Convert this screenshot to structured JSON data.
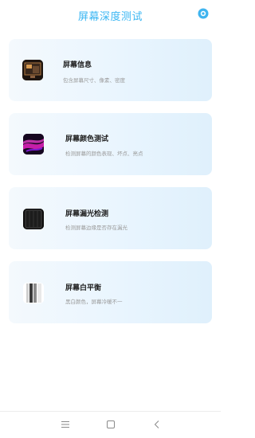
{
  "header": {
    "title": "屏幕深度测试",
    "settings_icon": "settings-icon",
    "accent_color": "#39b6f3"
  },
  "cards": [
    {
      "title": "屏幕信息",
      "desc": "包含屏幕尺寸、像素、密度",
      "icon": "screen-info-icon"
    },
    {
      "title": "屏幕颜色测试",
      "desc": "检测屏幕的颜色表现、坏点、亮点",
      "icon": "color-test-icon"
    },
    {
      "title": "屏幕漏光检测",
      "desc": "检测屏幕边缘是否存在漏光",
      "icon": "light-leak-icon"
    },
    {
      "title": "屏幕白平衡",
      "desc": "黑白颜色，屏幕冷暖不一",
      "icon": "white-balance-icon"
    }
  ],
  "navbar": {
    "items": [
      "menu-icon",
      "home-icon",
      "back-icon"
    ]
  }
}
